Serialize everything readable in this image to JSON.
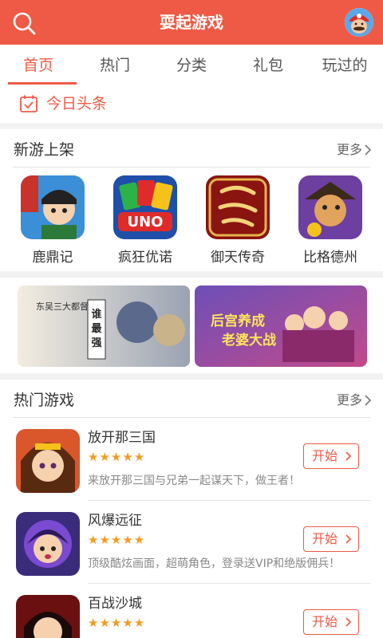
{
  "header": {
    "title": "耍起游戏",
    "search_icon": "search-icon",
    "avatar": "mario-avatar"
  },
  "tabs": [
    {
      "label": "首页",
      "active": true
    },
    {
      "label": "热门",
      "active": false
    },
    {
      "label": "分类",
      "active": false
    },
    {
      "label": "礼包",
      "active": false
    },
    {
      "label": "玩过的",
      "active": false
    }
  ],
  "headline": {
    "label": "今日头条",
    "icon": "calendar-check-icon"
  },
  "new_games": {
    "title": "新游上架",
    "more": "更多",
    "items": [
      {
        "name": "鹿鼎记",
        "icon_color": "#3a8fd6"
      },
      {
        "name": "疯狂优诺",
        "icon_color": "#1f4fa8"
      },
      {
        "name": "御天传奇",
        "icon_color": "#8a1410"
      },
      {
        "name": "比格德州",
        "icon_color": "#6c3fa0"
      }
    ]
  },
  "banners": [
    {
      "text_lines": [
        "谁最强",
        "东吴三大都督"
      ],
      "accent": "#b9a06e"
    },
    {
      "text_lines": [
        "后宫养成",
        "老婆大战"
      ],
      "accent": "#6d4fb8"
    }
  ],
  "hot_games": {
    "title": "热门游戏",
    "more": "更多",
    "items": [
      {
        "name": "放开那三国",
        "stars": "★★★★★",
        "desc": "来放开那三国与兄弟一起谋天下，做王者！",
        "button": "开始"
      },
      {
        "name": "风爆远征",
        "stars": "★★★★★",
        "desc": "顶级酷炫画面，超萌角色，登录送VIP和绝版佣兵！",
        "button": "开始"
      },
      {
        "name": "百战沙城",
        "stars": "★★★★★",
        "desc": "",
        "button": "开始"
      }
    ]
  },
  "colors": {
    "brand": "#ee5a45",
    "star": "#f59a1e"
  }
}
